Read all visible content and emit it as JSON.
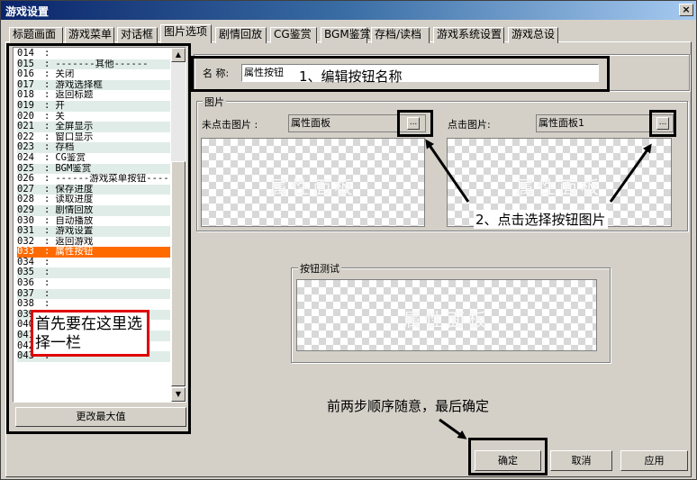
{
  "window": {
    "title": "游戏设置",
    "close_label": "×"
  },
  "tabs": [
    {
      "label": "标题画面"
    },
    {
      "label": "游戏菜单"
    },
    {
      "label": "对话框"
    },
    {
      "label": "图片选项"
    },
    {
      "label": "剧情回放"
    },
    {
      "label": "CG鉴赏"
    },
    {
      "label": "BGM鉴赏"
    },
    {
      "label": "存档/读档"
    },
    {
      "label": "游戏系统设置"
    },
    {
      "label": "游戏总设"
    }
  ],
  "list": {
    "items": [
      {
        "num": "014",
        "text": ""
      },
      {
        "num": "015",
        "text": "-------其他------"
      },
      {
        "num": "016",
        "text": "关闭"
      },
      {
        "num": "017",
        "text": "游戏选择框"
      },
      {
        "num": "018",
        "text": "返回标题"
      },
      {
        "num": "019",
        "text": "开"
      },
      {
        "num": "020",
        "text": "关"
      },
      {
        "num": "021",
        "text": "全屏显示"
      },
      {
        "num": "022",
        "text": "窗口显示"
      },
      {
        "num": "023",
        "text": "存档"
      },
      {
        "num": "024",
        "text": "CG鉴赏"
      },
      {
        "num": "025",
        "text": "BGM鉴赏"
      },
      {
        "num": "026",
        "text": "------游戏菜单按钮----"
      },
      {
        "num": "027",
        "text": "保存进度"
      },
      {
        "num": "028",
        "text": "读取进度"
      },
      {
        "num": "029",
        "text": "剧情回放"
      },
      {
        "num": "030",
        "text": "自动播放"
      },
      {
        "num": "031",
        "text": "游戏设置"
      },
      {
        "num": "032",
        "text": "返回游戏"
      },
      {
        "num": "033",
        "text": "属性按钮"
      },
      {
        "num": "034",
        "text": ""
      },
      {
        "num": "035",
        "text": ""
      },
      {
        "num": "036",
        "text": ""
      },
      {
        "num": "037",
        "text": ""
      },
      {
        "num": "038",
        "text": ""
      },
      {
        "num": "039",
        "text": ""
      },
      {
        "num": "040",
        "text": ""
      },
      {
        "num": "041",
        "text": ""
      },
      {
        "num": "042",
        "text": ""
      },
      {
        "num": "043",
        "text": ""
      }
    ],
    "selected_num": "033",
    "separator": ":",
    "max_button": "更改最大值"
  },
  "name_field": {
    "label": "名 称:",
    "value": "属性按钮"
  },
  "image_group": {
    "label": "图片",
    "unclicked_label": "未点击图片 :",
    "unclicked_value": "属性面板",
    "clicked_label": "点击图片:",
    "clicked_value": "属性面板1",
    "browse_label": "..."
  },
  "test_group": {
    "label": "按钮测试"
  },
  "watermark": "属性面板",
  "buttons": {
    "ok": "确定",
    "cancel": "取消",
    "apply": "应用"
  },
  "annotations": {
    "step1": "1、编辑按钮名称",
    "step2": "2、点击选择按钮图片",
    "first": "首先要在这里选择一栏",
    "final": "前两步顺序随意，最后确定"
  },
  "colors": {
    "selection": "#ff6a00",
    "annotation_red": "#e00000",
    "title_bar": "#0a246a"
  }
}
